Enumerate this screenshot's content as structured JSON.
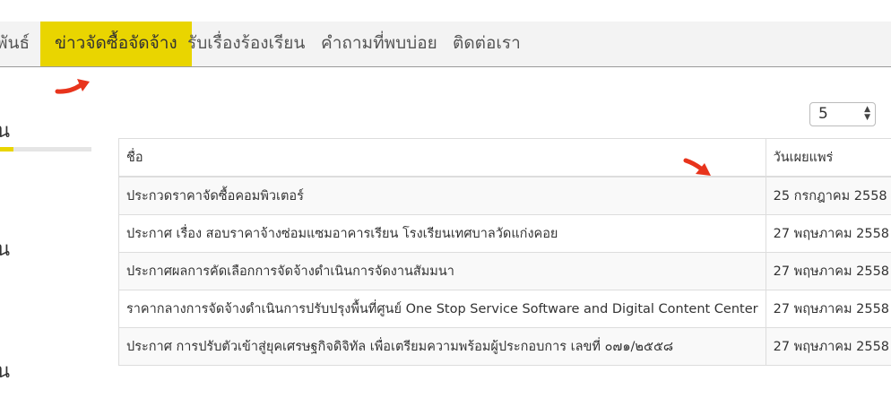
{
  "nav": {
    "items": [
      {
        "label": "พันธ์"
      },
      {
        "label": "ข่าวจัดซื้อจัดจ้าง"
      },
      {
        "label": "รับเรื่องร้องเรียน"
      },
      {
        "label": "คำถามที่พบบ่อย"
      },
      {
        "label": "ติดต่อเรา"
      }
    ],
    "active_color": "#e9d500"
  },
  "sidebar": {
    "items": [
      {
        "label": "น"
      },
      {
        "label": "น"
      },
      {
        "label": "น"
      }
    ]
  },
  "page_size": {
    "value": "5"
  },
  "table": {
    "headers": {
      "name": "ชื่อ",
      "date": "วันเผยแพร่"
    },
    "rows": [
      {
        "name": "ประกวดราคาจัดซื้อคอมพิวเตอร์",
        "date": "25 กรกฎาคม 2558"
      },
      {
        "name": "ประกาศ เรื่อง สอบราคาจ้างซ่อมแซมอาคารเรียน โรงเรียนเทศบาลวัดแก่งคอย",
        "date": "27 พฤษภาคม 2558"
      },
      {
        "name": "ประกาศผลการคัดเลือกการจัดจ้างดำเนินการจัดงานสัมมนา",
        "date": "27 พฤษภาคม 2558"
      },
      {
        "name": "ราคากลางการจัดจ้างดำเนินการปรับปรุงพื้นที่ศูนย์ One Stop Service Software and Digital Content Center",
        "date": "27 พฤษภาคม 2558"
      },
      {
        "name": "ประกาศ การปรับตัวเข้าสู่ยุคเศรษฐกิจดิจิทัล เพื่อเตรียมความพร้อมผู้ประกอบการ เลขที่ ๐๗๑/๒๕๕๘",
        "date": "27 พฤษภาคม 2558"
      }
    ]
  },
  "annotation_color": "#e8341c"
}
